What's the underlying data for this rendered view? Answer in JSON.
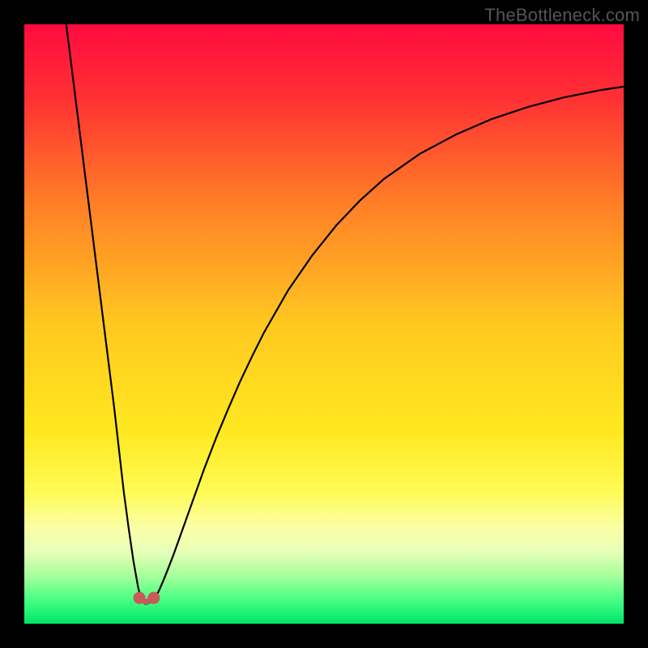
{
  "watermark": "TheBottleneck.com",
  "chart_data": {
    "type": "line",
    "title": "",
    "xlabel": "",
    "ylabel": "",
    "xlim": [
      0,
      100
    ],
    "ylim": [
      0,
      100
    ],
    "grid": false,
    "legend": false,
    "background_gradient": {
      "stops": [
        {
          "offset": 0.0,
          "color": "#ff0b3f"
        },
        {
          "offset": 0.12,
          "color": "#ff2f34"
        },
        {
          "offset": 0.3,
          "color": "#ff7f27"
        },
        {
          "offset": 0.5,
          "color": "#ffc820"
        },
        {
          "offset": 0.68,
          "color": "#ffe820"
        },
        {
          "offset": 0.78,
          "color": "#fffb55"
        },
        {
          "offset": 0.84,
          "color": "#fbffa6"
        },
        {
          "offset": 0.88,
          "color": "#e6ffb8"
        },
        {
          "offset": 0.92,
          "color": "#a6ff9a"
        },
        {
          "offset": 0.96,
          "color": "#47ff83"
        },
        {
          "offset": 1.0,
          "color": "#00e56a"
        }
      ]
    },
    "series": [
      {
        "name": "bottleneck-curve",
        "color": "#000000",
        "stroke_width": 2.2,
        "x": [
          7.0,
          8.0,
          9.0,
          10.0,
          11.0,
          12.0,
          13.0,
          14.0,
          15.0,
          15.8,
          16.6,
          17.4,
          18.2,
          19.0,
          19.4,
          19.8,
          20.2,
          20.8,
          21.4,
          22.0,
          22.6,
          23.2,
          24.0,
          25.0,
          26.0,
          27.0,
          28.0,
          30.0,
          32.0,
          34.0,
          36.0,
          38.0,
          40.0,
          44.0,
          48.0,
          52.0,
          56.0,
          60.0,
          66.0,
          72.0,
          78.0,
          84.0,
          90.0,
          96.0,
          100.0
        ],
        "y": [
          100.0,
          92.0,
          84.0,
          76.0,
          68.0,
          60.0,
          52.0,
          44.0,
          36.0,
          29.0,
          22.0,
          16.0,
          10.5,
          6.0,
          4.5,
          3.6,
          3.3,
          3.4,
          3.8,
          4.6,
          5.8,
          7.2,
          9.2,
          11.8,
          14.6,
          17.4,
          20.2,
          25.8,
          31.0,
          35.8,
          40.4,
          44.6,
          48.6,
          55.6,
          61.4,
          66.4,
          70.6,
          74.2,
          78.4,
          81.6,
          84.2,
          86.2,
          87.8,
          89.0,
          89.6
        ]
      }
    ],
    "markers": [
      {
        "name": "valley-markers",
        "type": "dots-with-link",
        "color": "#c85a5a",
        "dot_radius": 7.5,
        "link_width": 7,
        "points": [
          {
            "x": 19.2,
            "y": 4.3
          },
          {
            "x": 21.6,
            "y": 4.3
          }
        ]
      }
    ]
  }
}
